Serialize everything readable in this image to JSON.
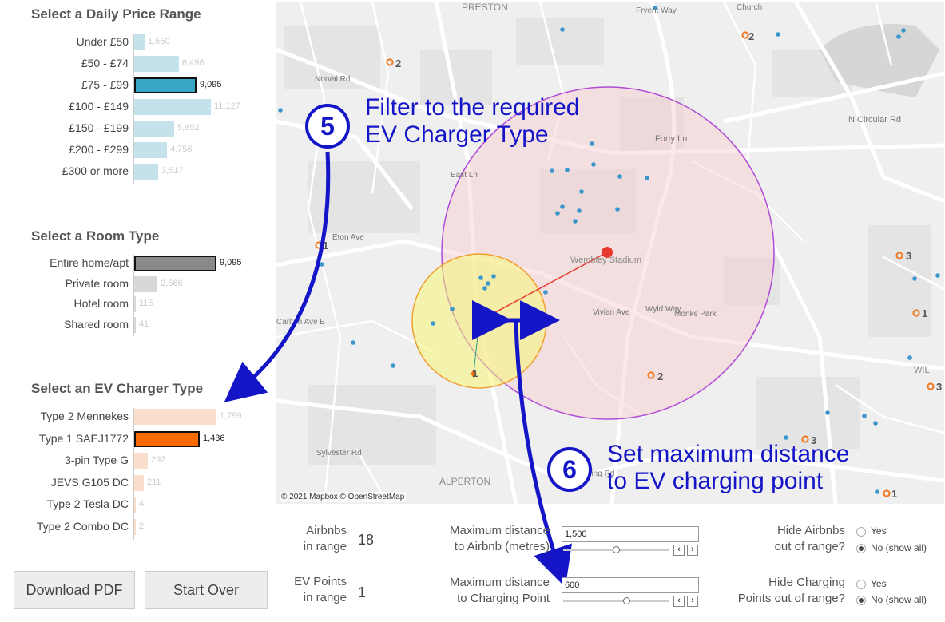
{
  "price_filter": {
    "title": "Select a Daily Price Range",
    "items": [
      {
        "label": "Under £50",
        "value": "1,550",
        "n": 1550,
        "selected": false
      },
      {
        "label": "£50 - £74",
        "value": "6,498",
        "n": 6498,
        "selected": false
      },
      {
        "label": "£75 - £99",
        "value": "9,095",
        "n": 9095,
        "selected": true
      },
      {
        "label": "£100 - £149",
        "value": "11,127",
        "n": 11127,
        "selected": false
      },
      {
        "label": "£150 - £199",
        "value": "5,852",
        "n": 5852,
        "selected": false
      },
      {
        "label": "£200 - £299",
        "value": "4,756",
        "n": 4756,
        "selected": false
      },
      {
        "label": "£300 or more",
        "value": "3,517",
        "n": 3517,
        "selected": false
      }
    ]
  },
  "room_filter": {
    "title": "Select a Room Type",
    "items": [
      {
        "label": "Entire home/apt",
        "value": "9,095",
        "n": 9095,
        "selected": true
      },
      {
        "label": "Private room",
        "value": "2,566",
        "n": 2566,
        "selected": false
      },
      {
        "label": "Hotel room",
        "value": "115",
        "n": 115,
        "selected": false
      },
      {
        "label": "Shared room",
        "value": "41",
        "n": 41,
        "selected": false
      }
    ]
  },
  "ev_filter": {
    "title": "Select an EV Charger Type",
    "items": [
      {
        "label": "Type 2 Mennekes",
        "value": "1,799",
        "n": 1799,
        "selected": false
      },
      {
        "label": "Type 1 SAEJ1772",
        "value": "1,436",
        "n": 1436,
        "selected": true
      },
      {
        "label": "3-pin Type G",
        "value": "292",
        "n": 292,
        "selected": false
      },
      {
        "label": "JEVS G105 DC",
        "value": "211",
        "n": 211,
        "selected": false
      },
      {
        "label": "Type 2 Tesla DC",
        "value": "4",
        "n": 4,
        "selected": false
      },
      {
        "label": "Type 2 Combo DC",
        "value": "2",
        "n": 2,
        "selected": false
      }
    ]
  },
  "buttons": {
    "download": "Download PDF",
    "start_over": "Start Over"
  },
  "map": {
    "credit": "© 2021 Mapbox © OpenStreetMap",
    "places": [
      "PRESTON",
      "ALPERTON",
      "Wembley Stadium",
      "WIL"
    ],
    "roads": [
      "Norval Rd",
      "Eton Ave",
      "East Ln",
      "Forty Ln",
      "N Circular Rd",
      "Vivian Ave",
      "Wyld Way",
      "Monks Park",
      "Fryent Way",
      "Church",
      "Carlton Ave E",
      "Ealing Rd",
      "Sylvester Rd"
    ],
    "counts": [
      "2",
      "2",
      "1",
      "3",
      "1",
      "2",
      "3",
      "3",
      "1",
      "1"
    ]
  },
  "annotations": {
    "step5": {
      "number": "5",
      "line1": "Filter to the required",
      "line2": "EV Charger Type"
    },
    "step6": {
      "number": "6",
      "line1": "Set maximum distance",
      "line2": "to EV charging point"
    }
  },
  "controls": {
    "airbnbs_label1": "Airbnbs",
    "airbnbs_label2": "in range",
    "airbnbs_value": "18",
    "ev_points_label1": "EV Points",
    "ev_points_label2": "in range",
    "ev_points_value": "1",
    "max_airbnb_label1": "Maximum distance",
    "max_airbnb_label2": "to Airbnb (metres)",
    "max_airbnb_value": "1,500",
    "max_airbnb_level": 0.5,
    "max_charging_label1": "Maximum distance",
    "max_charging_label2": "to Charging Point",
    "max_charging_value": "600",
    "max_charging_level": 0.6,
    "hide_airbnbs_label1": "Hide Airbnbs",
    "hide_airbnbs_label2": "out of range?",
    "hide_charging_label1": "Hide Charging",
    "hide_charging_label2": "Points out of range?",
    "yes": "Yes",
    "no_show_all": "No (show all)"
  },
  "colors": {
    "price": "#6fb0c8",
    "room": "#8a8a8a",
    "ev": "#ff6a00",
    "annotation": "#1515c8"
  }
}
